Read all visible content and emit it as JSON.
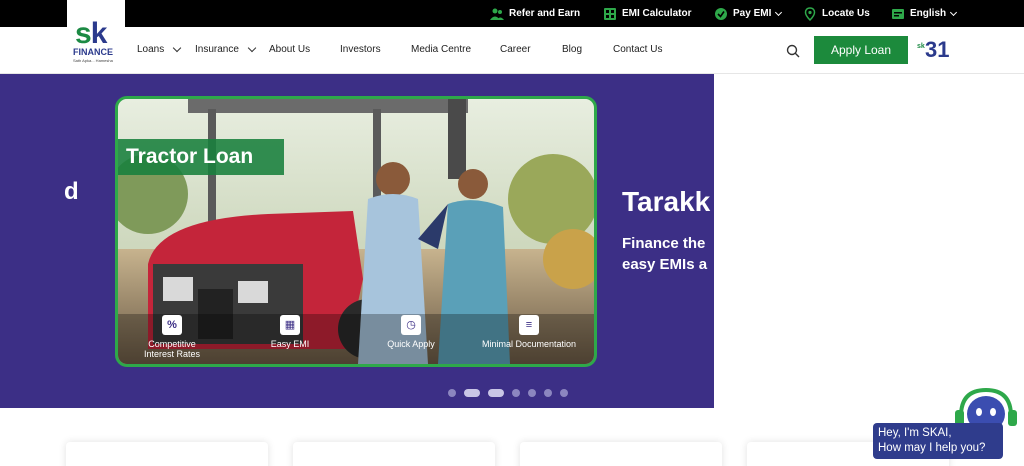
{
  "topbar": {
    "refer": "Refer and Earn",
    "emi_calc": "EMI Calculator",
    "pay_emi": "Pay EMI",
    "locate": "Locate Us",
    "language": "English"
  },
  "logo": {
    "brand_s": "s",
    "brand_k": "k",
    "finance": "FINANCE",
    "tagline": "Sath Apka... Hamesha"
  },
  "nav": {
    "loans": "Loans",
    "insurance": "Insurance",
    "about": "About Us",
    "investors": "Investors",
    "media": "Media Centre",
    "career": "Career",
    "blog": "Blog",
    "contact": "Contact Us",
    "apply": "Apply Loan",
    "badge_small": "sk",
    "badge_big": "31"
  },
  "hero": {
    "prev_fragment": "d",
    "slide_title": "Tractor Loan",
    "features": [
      {
        "icon": "%",
        "label1": "Competitive",
        "label2": "Interest Rates"
      },
      {
        "icon": "▦",
        "label1": "Easy EMI",
        "label2": ""
      },
      {
        "icon": "◷",
        "label1": "Quick Apply",
        "label2": ""
      },
      {
        "icon": "≡",
        "label1": "Minimal Documentation",
        "label2": ""
      }
    ],
    "next_title": "Tarakk",
    "next_sub1": "Finance the",
    "next_sub2": "easy EMIs a"
  },
  "carousel": {
    "active_index": 1,
    "count": 7
  },
  "chatbot": {
    "line1": "Hey, I'm SKAI,",
    "line2": "How may I help you?"
  },
  "colors": {
    "brand_green": "#1c8a3c",
    "hero_purple": "#3c2f86",
    "brand_blue": "#2b3a8c"
  }
}
